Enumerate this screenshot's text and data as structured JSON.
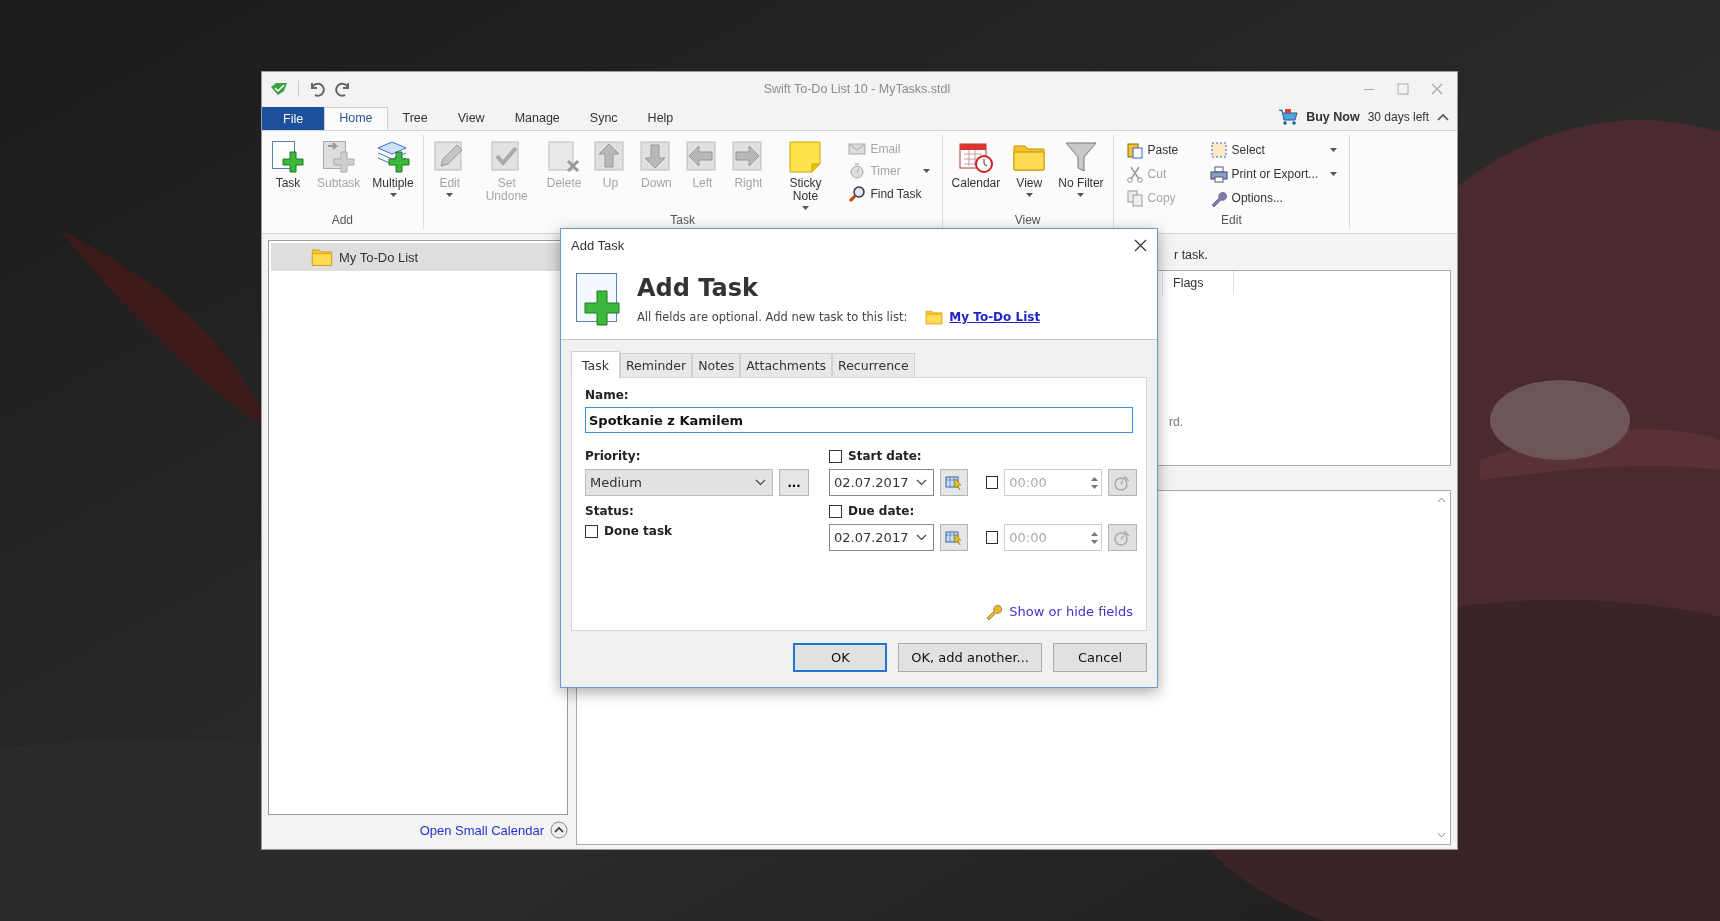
{
  "window": {
    "title": "Swift To-Do List 10 - MyTasks.stdl",
    "buy_now": "Buy Now",
    "trial": "30 days left"
  },
  "menu_tabs": [
    {
      "label": "File",
      "kind": "file",
      "selected": false
    },
    {
      "label": "Home",
      "kind": "tab",
      "selected": true
    },
    {
      "label": "Tree",
      "kind": "tab",
      "selected": false
    },
    {
      "label": "View",
      "kind": "tab",
      "selected": false
    },
    {
      "label": "Manage",
      "kind": "tab",
      "selected": false
    },
    {
      "label": "Sync",
      "kind": "tab",
      "selected": false
    },
    {
      "label": "Help",
      "kind": "tab",
      "selected": false
    }
  ],
  "ribbon": [
    {
      "label": "Add",
      "items": [
        {
          "label": "Task",
          "kind": "large",
          "disabled": false,
          "dropdown": false
        },
        {
          "label": "Subtask",
          "kind": "large",
          "disabled": true,
          "dropdown": false
        },
        {
          "label": "Multiple",
          "kind": "large",
          "disabled": false,
          "dropdown": true
        }
      ]
    },
    {
      "label": "Task",
      "items": [
        {
          "label": "Edit",
          "kind": "large",
          "disabled": true,
          "dropdown": true
        },
        {
          "label": "Set Undone",
          "kind": "large",
          "disabled": true,
          "dropdown": false
        },
        {
          "label": "Delete",
          "kind": "large",
          "disabled": true,
          "dropdown": false
        },
        {
          "label": "Up",
          "kind": "large",
          "disabled": true,
          "dropdown": false
        },
        {
          "label": "Down",
          "kind": "large",
          "disabled": true,
          "dropdown": false
        },
        {
          "label": "Left",
          "kind": "large",
          "disabled": true,
          "dropdown": false
        },
        {
          "label": "Right",
          "kind": "large",
          "disabled": true,
          "dropdown": false
        },
        {
          "label": "Sticky Note",
          "kind": "large",
          "disabled": false,
          "dropdown": true
        },
        {
          "label": "Email",
          "kind": "small",
          "disabled": true,
          "dropdown": false
        },
        {
          "label": "Timer",
          "kind": "small",
          "disabled": true,
          "dropdown": true
        },
        {
          "label": "Find Task",
          "kind": "small",
          "disabled": false,
          "dropdown": false
        }
      ]
    },
    {
      "label": "View",
      "items": [
        {
          "label": "Calendar",
          "kind": "large",
          "disabled": false,
          "dropdown": false
        },
        {
          "label": "View",
          "kind": "large",
          "disabled": false,
          "dropdown": true
        },
        {
          "label": "No Filter",
          "kind": "large",
          "disabled": false,
          "dropdown": true
        }
      ]
    },
    {
      "label": "Edit",
      "items": [
        {
          "label": "Paste",
          "kind": "small",
          "disabled": false,
          "dropdown": false
        },
        {
          "label": "Cut",
          "kind": "small",
          "disabled": true,
          "dropdown": false
        },
        {
          "label": "Copy",
          "kind": "small",
          "disabled": true,
          "dropdown": false
        },
        {
          "label": "Select",
          "kind": "small",
          "disabled": false,
          "dropdown": true
        },
        {
          "label": "Print or Export...",
          "kind": "small",
          "disabled": false,
          "dropdown": true
        },
        {
          "label": "Options...",
          "kind": "small",
          "disabled": false,
          "dropdown": false
        }
      ]
    }
  ],
  "tree": [
    {
      "label": "My To-Do List",
      "selected": true
    }
  ],
  "calendar_link": "Open Small Calendar",
  "task_list": {
    "header_text": "r task.",
    "columns": [
      "Flags"
    ],
    "empty_text": "rd."
  },
  "dialog": {
    "title": "Add Task",
    "heading": "Add Task",
    "subtitle": "All fields are optional. Add new task to this list:",
    "list_link": "My To-Do List",
    "tabs": [
      {
        "label": "Task",
        "selected": true
      },
      {
        "label": "Reminder",
        "selected": false
      },
      {
        "label": "Notes",
        "selected": false
      },
      {
        "label": "Attachments",
        "selected": false
      },
      {
        "label": "Recurrence",
        "selected": false
      }
    ],
    "name": {
      "label": "Name:",
      "value": "Spotkanie z Kamilem"
    },
    "priority": {
      "label": "Priority:",
      "value": "Medium",
      "more": "..."
    },
    "start_date": {
      "label": "Start date:",
      "checked": false,
      "date": "02.07.2017",
      "time": "00:00",
      "time_checked": false
    },
    "status": {
      "label": "Status:",
      "done_label": "Done task",
      "done": false
    },
    "due_date": {
      "label": "Due date:",
      "checked": false,
      "date": "02.07.2017",
      "time": "00:00",
      "time_checked": false
    },
    "fields_link": "Show or hide fields",
    "buttons": [
      {
        "label": "OK",
        "default": true
      },
      {
        "label": "OK, add another...",
        "default": false
      },
      {
        "label": "Cancel",
        "default": false
      }
    ]
  }
}
